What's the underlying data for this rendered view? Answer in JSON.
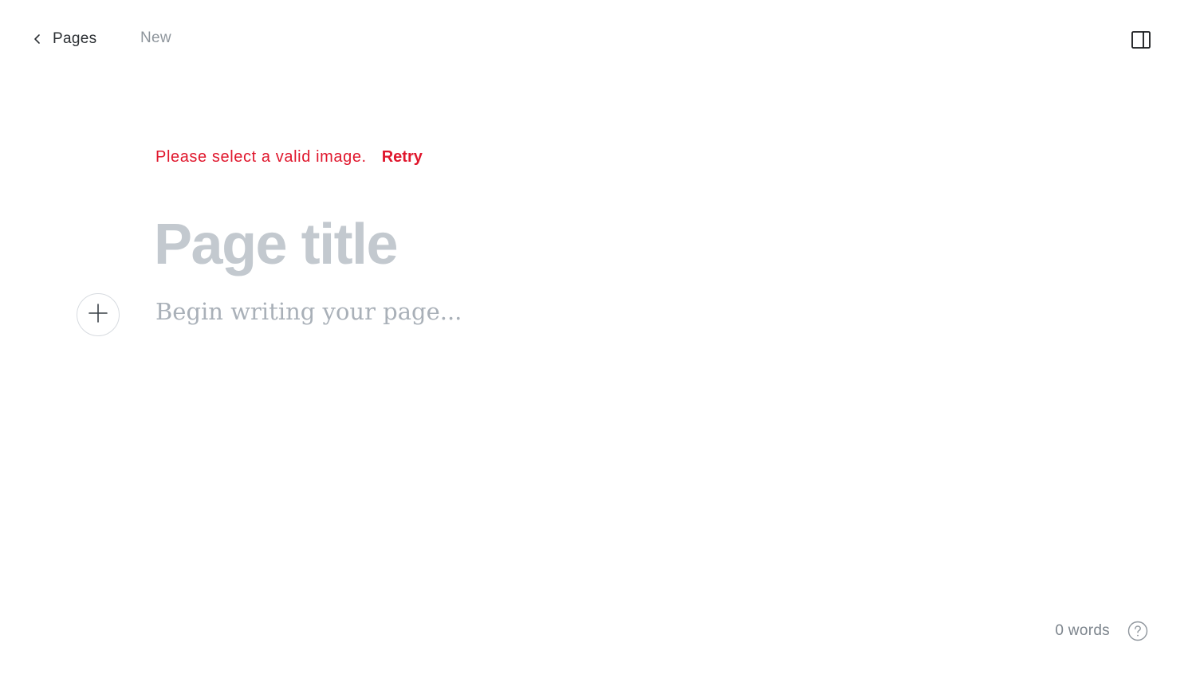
{
  "header": {
    "back_label": "Pages",
    "status": "New",
    "back_icon": "chevron-left-icon",
    "panel_icon": "sidebar-toggle-icon"
  },
  "editor": {
    "error_message": "Please select a valid image.",
    "retry_label": "Retry",
    "title_placeholder": "Page title",
    "body_placeholder": "Begin writing your page..."
  },
  "footer": {
    "word_count": "0 words",
    "help_icon": "help-icon"
  },
  "colors": {
    "error": "#e0172d",
    "placeholder_title": "#c3c9cf",
    "placeholder_body": "#a9b0b8",
    "muted": "#8e959c"
  }
}
